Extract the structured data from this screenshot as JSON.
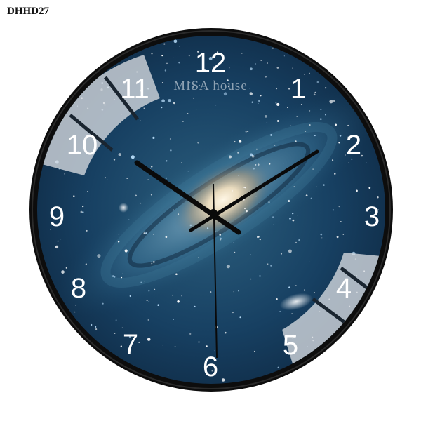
{
  "product_code": "DHHD27",
  "brand_watermark": "MISA house",
  "dial_numbers": [
    "12",
    "1",
    "2",
    "3",
    "4",
    "5",
    "6",
    "7",
    "8",
    "9",
    "10",
    "11"
  ],
  "colors": {
    "frame": "#111111",
    "dial_deep": "#0a1a30",
    "dial_mid": "#1d4a6a",
    "galaxy_core": "#f3e6c6",
    "numerals": "#ffffff",
    "glare": "#c9cdd2"
  },
  "time_shown": {
    "hours": "10",
    "minutes": "09",
    "seconds": "29"
  }
}
